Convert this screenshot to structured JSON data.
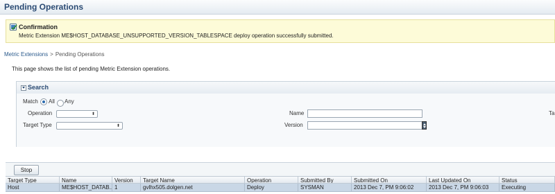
{
  "page": {
    "title": "Pending Operations"
  },
  "confirmation": {
    "title": "Confirmation",
    "message": "Metric Extension ME$HOST_DATABASE_UNSUPPORTED_VERSION_TABLESPACE deploy operation successfully submitted."
  },
  "breadcrumb": {
    "link": "Metric Extensions",
    "separator": ">",
    "current": "Pending Operations"
  },
  "description": "This page shows the list of pending Metric Extension operations.",
  "search": {
    "title": "Search",
    "match_label": "Match",
    "match_all": "All",
    "match_any": "Any",
    "match_selected": "All",
    "operation_label": "Operation",
    "operation_value": "",
    "target_type_label": "Target Type",
    "target_type_value": "",
    "name_label": "Name",
    "name_value": "",
    "version_label": "Version",
    "version_value": "",
    "cut_label": "Ta"
  },
  "toolbar": {
    "stop_label": "Stop"
  },
  "table": {
    "columns": [
      "Target Type",
      "Name",
      "Version",
      "Target Name",
      "Operation",
      "Submitted By",
      "Submitted On",
      "Last Updated On",
      "Status"
    ],
    "rows": [
      [
        "Host",
        "ME$HOST_DATAB...",
        "1",
        "gvlhx505.dolgen.net",
        "Deploy",
        "SYSMAN",
        "2013 Dec 7, PM 9:06:02",
        "2013 Dec 7, PM 9:06:03",
        "Executing"
      ]
    ]
  },
  "colors": {
    "title": "#2a4a73",
    "confirm_bg": "#fdfbd8",
    "selected_row": "#c9d7e6",
    "link": "#2a5a8c"
  }
}
